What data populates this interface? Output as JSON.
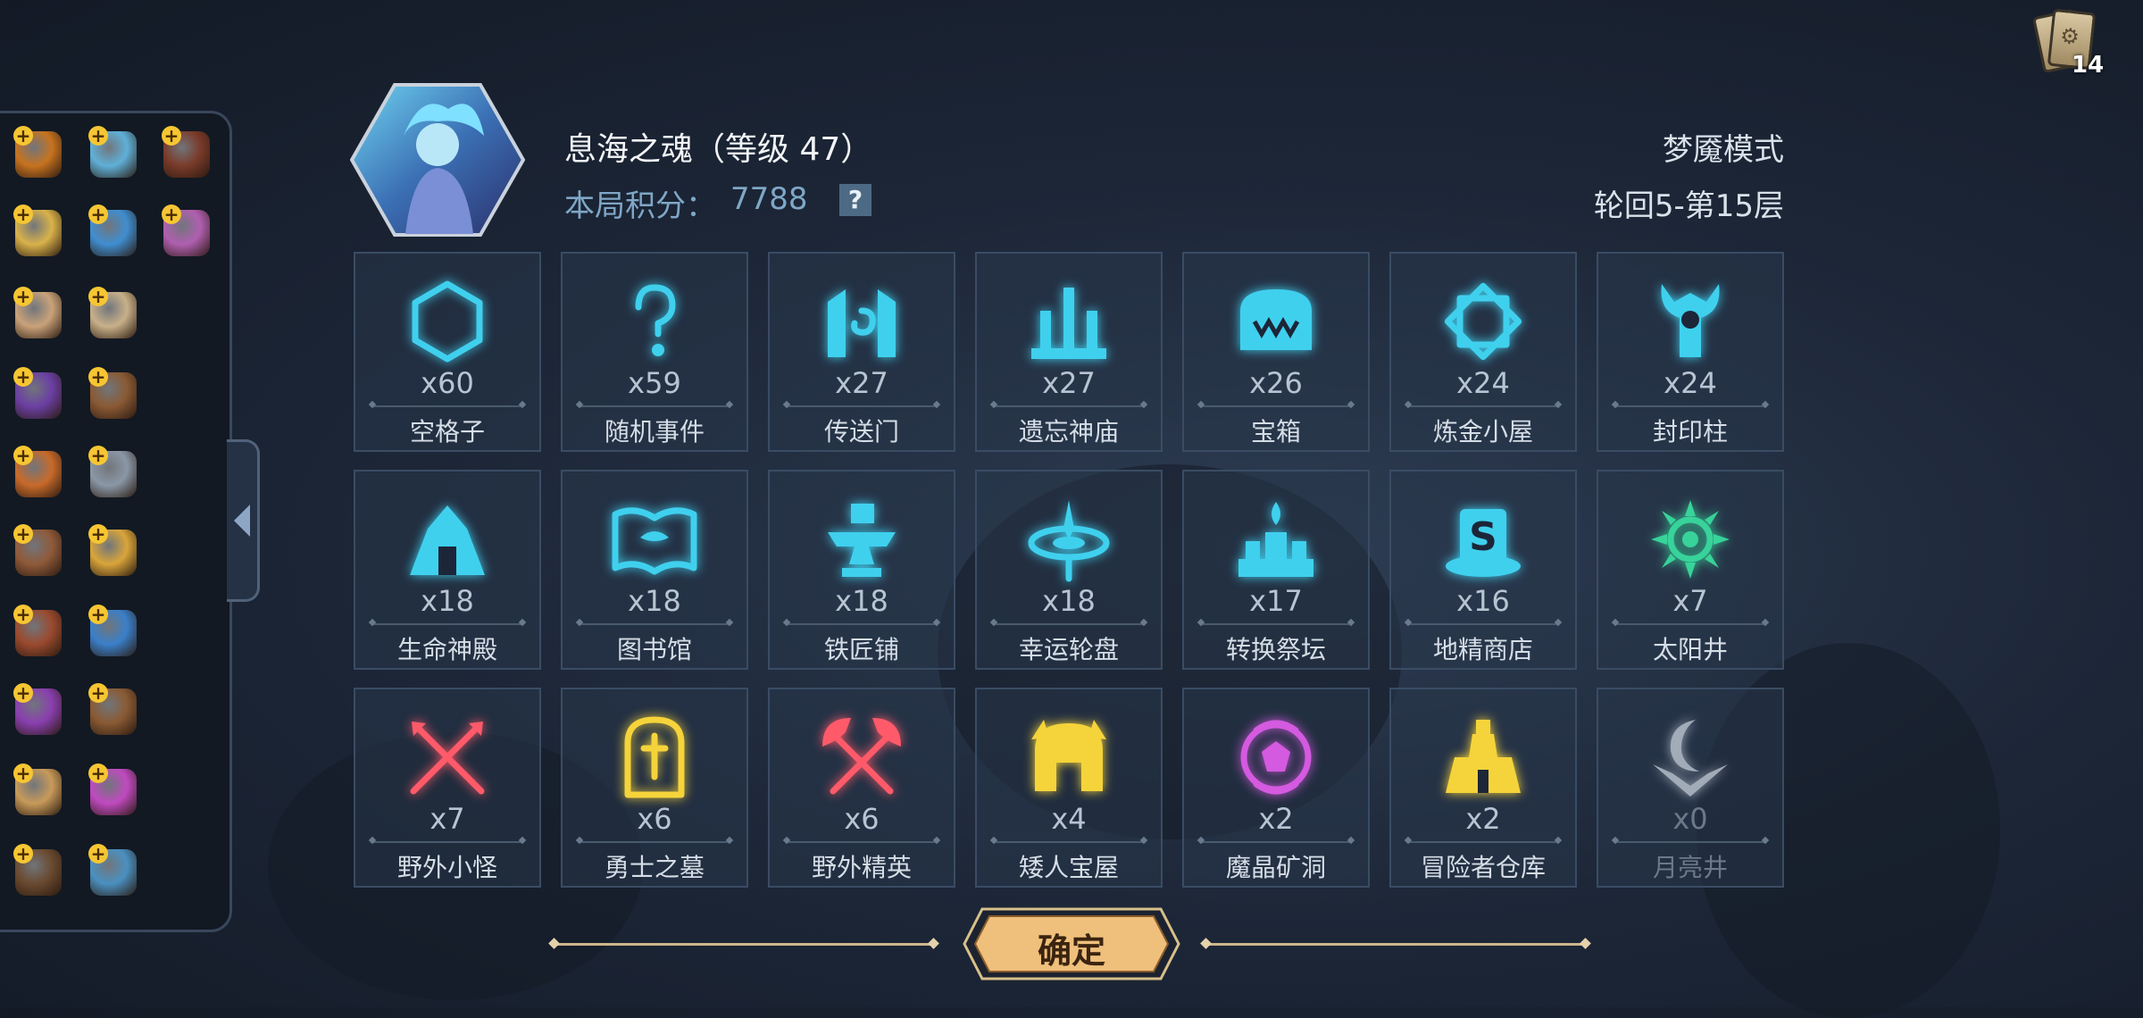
{
  "top_right": {
    "card_count": "14"
  },
  "inventory": {
    "items": [
      {
        "name": "torch",
        "color": "#c7731f"
      },
      {
        "name": "flower-bouquet",
        "color": "#5fb0d8"
      },
      {
        "name": "bagpipe",
        "color": "#7a3b2a"
      },
      {
        "name": "pocket-watch",
        "color": "#d9b24a"
      },
      {
        "name": "dragon-egg",
        "color": "#3f8ed0"
      },
      {
        "name": "pearl-shell",
        "color": "#b05fb0"
      },
      {
        "name": "sealed-scroll",
        "color": "#c9a27a"
      },
      {
        "name": "parchment",
        "color": "#c8b089"
      },
      {
        "name": "wizard-hat",
        "color": "#6b3fa3"
      },
      {
        "name": "wooden-box",
        "color": "#8a5a34"
      },
      {
        "name": "spiked-shell",
        "color": "#c86a2a"
      },
      {
        "name": "war-hammer",
        "color": "#8a97a6"
      },
      {
        "name": "spiked-ring",
        "color": "#8f5a3a"
      },
      {
        "name": "golden-key",
        "color": "#d9a53a"
      },
      {
        "name": "rock-fire",
        "color": "#9a4a2e"
      },
      {
        "name": "pinwheel",
        "color": "#3a7fc9"
      },
      {
        "name": "purple-orb",
        "color": "#8a3fb0"
      },
      {
        "name": "leather-bag",
        "color": "#8a5a34"
      },
      {
        "name": "treasure-map",
        "color": "#c89a5a"
      },
      {
        "name": "pink-potion",
        "color": "#c04ac0"
      },
      {
        "name": "spell-book",
        "color": "#6a4a30"
      },
      {
        "name": "treasure-chest",
        "color": "#4a90c0"
      }
    ]
  },
  "header": {
    "hero_name": "息海之魂（等级 47）",
    "score_label": "本局积分：",
    "score_value": "7788",
    "help": "?",
    "mode": "梦魇模式",
    "floor": "轮回5-第15层"
  },
  "tiles": [
    {
      "icon": "hexagon-icon",
      "count": "x60",
      "label": "空格子",
      "color": "#3fd0ee"
    },
    {
      "icon": "question-icon",
      "count": "x59",
      "label": "随机事件",
      "color": "#3fd0ee"
    },
    {
      "icon": "portal-icon",
      "count": "x27",
      "label": "传送门",
      "color": "#3fd0ee"
    },
    {
      "icon": "temple-icon",
      "count": "x27",
      "label": "遗忘神庙",
      "color": "#3fd0ee"
    },
    {
      "icon": "chest-icon",
      "count": "x26",
      "label": "宝箱",
      "color": "#3fd0ee"
    },
    {
      "icon": "alchemy-icon",
      "count": "x24",
      "label": "炼金小屋",
      "color": "#3fd0ee"
    },
    {
      "icon": "seal-pillar-icon",
      "count": "x24",
      "label": "封印柱",
      "color": "#3fd0ee"
    },
    {
      "icon": "life-temple-icon",
      "count": "x18",
      "label": "生命神殿",
      "color": "#3fd0ee"
    },
    {
      "icon": "library-icon",
      "count": "x18",
      "label": "图书馆",
      "color": "#3fd0ee"
    },
    {
      "icon": "anvil-icon",
      "count": "x18",
      "label": "铁匠铺",
      "color": "#3fd0ee"
    },
    {
      "icon": "wheel-icon",
      "count": "x18",
      "label": "幸运轮盘",
      "color": "#3fd0ee"
    },
    {
      "icon": "altar-icon",
      "count": "x17",
      "label": "转换祭坛",
      "color": "#3fd0ee"
    },
    {
      "icon": "shop-icon",
      "count": "x16",
      "label": "地精商店",
      "color": "#3fd0ee"
    },
    {
      "icon": "sun-well-icon",
      "count": "x7",
      "label": "太阳井",
      "color": "#38d39a"
    },
    {
      "icon": "crossed-swords-icon",
      "count": "x7",
      "label": "野外小怪",
      "color": "#ff5a6a"
    },
    {
      "icon": "tomb-icon",
      "count": "x6",
      "label": "勇士之墓",
      "color": "#f5d33a"
    },
    {
      "icon": "crossed-axes-icon",
      "count": "x6",
      "label": "野外精英",
      "color": "#ff5a6a"
    },
    {
      "icon": "dwarf-house-icon",
      "count": "x4",
      "label": "矮人宝屋",
      "color": "#f5d33a"
    },
    {
      "icon": "crystal-mine-icon",
      "count": "x2",
      "label": "魔晶矿洞",
      "color": "#d45ae0"
    },
    {
      "icon": "warehouse-icon",
      "count": "x2",
      "label": "冒险者仓库",
      "color": "#f5d33a"
    },
    {
      "icon": "moon-well-icon",
      "count": "x0",
      "label": "月亮井",
      "color": "#d8e0ea"
    }
  ],
  "confirm_label": "确定"
}
